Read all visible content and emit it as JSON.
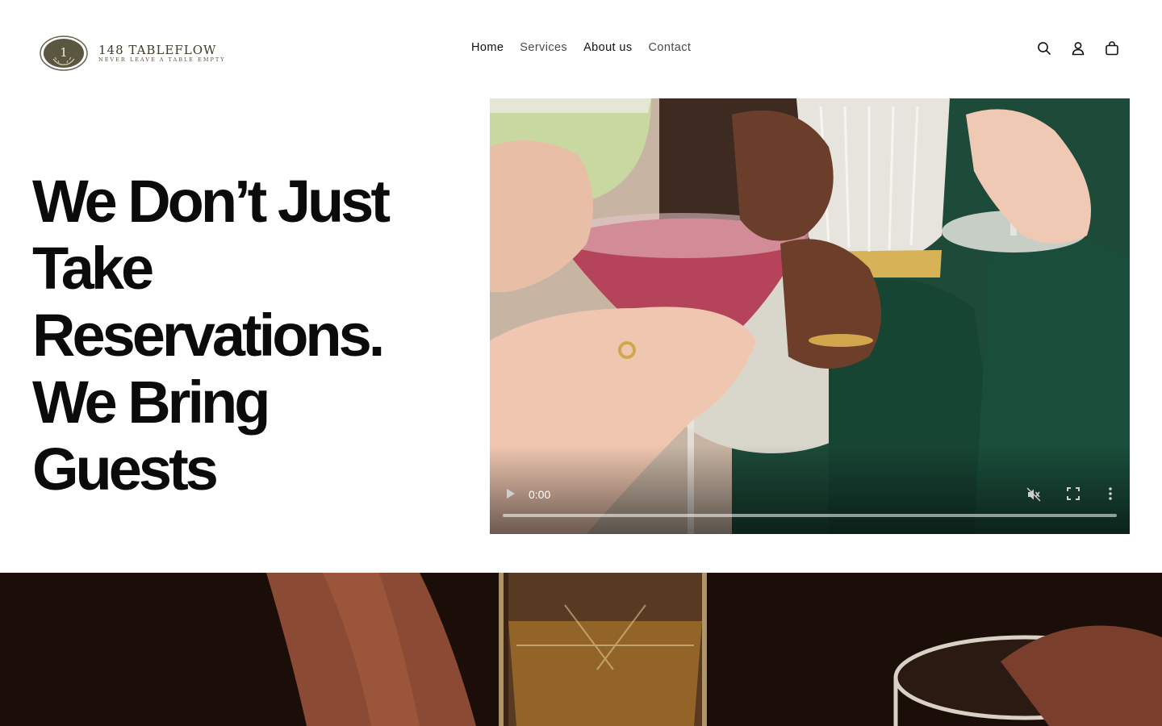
{
  "brand": {
    "emblem_text": "1",
    "name": "148 TABLEFLOW",
    "tagline": "NEVER LEAVE A TABLE EMPTY"
  },
  "nav": {
    "items": [
      {
        "label": "Home",
        "active": true
      },
      {
        "label": "Services",
        "active": false
      },
      {
        "label": "About us",
        "active": false
      },
      {
        "label": "Contact",
        "active": false
      }
    ]
  },
  "header_icons": [
    "search-icon",
    "account-icon",
    "cart-icon"
  ],
  "hero": {
    "heading_lines": [
      "We Don’t Just",
      "Take",
      "Reservations.",
      "We Bring",
      "Guests"
    ]
  },
  "video": {
    "time": "0:00",
    "progress": 0,
    "muted": true
  },
  "colors": {
    "text": "#0b0b0b",
    "nav_muted": "#4a4a4a",
    "brand": "#3f3a2a",
    "banner_bg": "#1b0d08"
  }
}
